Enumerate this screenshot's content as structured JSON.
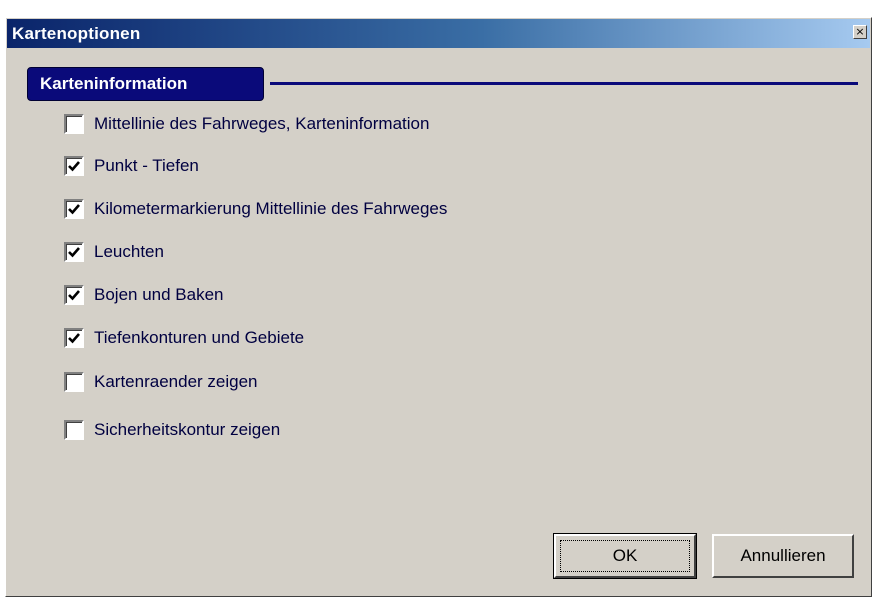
{
  "window": {
    "title": "Kartenoptionen",
    "close_glyph": "×"
  },
  "group": {
    "title": "Karteninformation"
  },
  "options": [
    {
      "label": "Mittellinie des Fahrweges, Karteninformation",
      "checked": false
    },
    {
      "label": "Punkt - Tiefen",
      "checked": true
    },
    {
      "label": "Kilometermarkierung Mittellinie des Fahrweges",
      "checked": true
    },
    {
      "label": "Leuchten",
      "checked": true
    },
    {
      "label": "Bojen und Baken",
      "checked": true
    },
    {
      "label": "Tiefenkonturen und Gebiete",
      "checked": true
    },
    {
      "label": "Kartenraender zeigen",
      "checked": false
    },
    {
      "label": "Sicherheitskontur zeigen",
      "checked": false
    }
  ],
  "buttons": {
    "ok_label": "OK",
    "cancel_label": "Annullieren"
  },
  "colors": {
    "title_gradient_start": "#0a246a",
    "title_gradient_end": "#a6caf0",
    "group_accent": "#0a0a7a",
    "dialog_face": "#d4d0c8"
  }
}
